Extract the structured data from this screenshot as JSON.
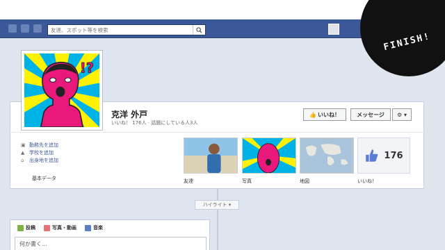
{
  "nav": {
    "search_placeholder": "友達、スポット等を検索",
    "search_icon": "magnifier-icon"
  },
  "overlay": {
    "finish_label": "FINISH!"
  },
  "profile": {
    "name": "克洋 外戸",
    "stats": "いいね！ 176人 · 話題にしている人3人"
  },
  "actions": {
    "like_label": "いいね！",
    "message_label": "メッセージ",
    "gear_label": "⚙ ▾"
  },
  "info": {
    "items": [
      {
        "icon": "briefcase-icon",
        "label": "勤務先を追加"
      },
      {
        "icon": "school-icon",
        "label": "学校を追加"
      },
      {
        "icon": "home-icon",
        "label": "出身地を追加"
      }
    ],
    "basic_data_label": "基本データ"
  },
  "tiles": {
    "friends_label": "友達",
    "photos_label": "写真",
    "map_label": "地図",
    "likes_label": "いいね！",
    "likes_count": "176"
  },
  "timeline": {
    "highlight_label": "ハイライト ▾"
  },
  "composer": {
    "tabs": [
      {
        "label": "投稿",
        "color": "#7cb342"
      },
      {
        "label": "写真・動画",
        "color": "#e57373"
      },
      {
        "label": "音楽",
        "color": "#5c7fc2"
      }
    ],
    "placeholder": "何か書く..."
  },
  "colors": {
    "nav_bg": "#3b5998",
    "pop_pink": "#e8197a",
    "pop_yellow": "#fff200",
    "pop_cyan": "#00b3e6"
  }
}
